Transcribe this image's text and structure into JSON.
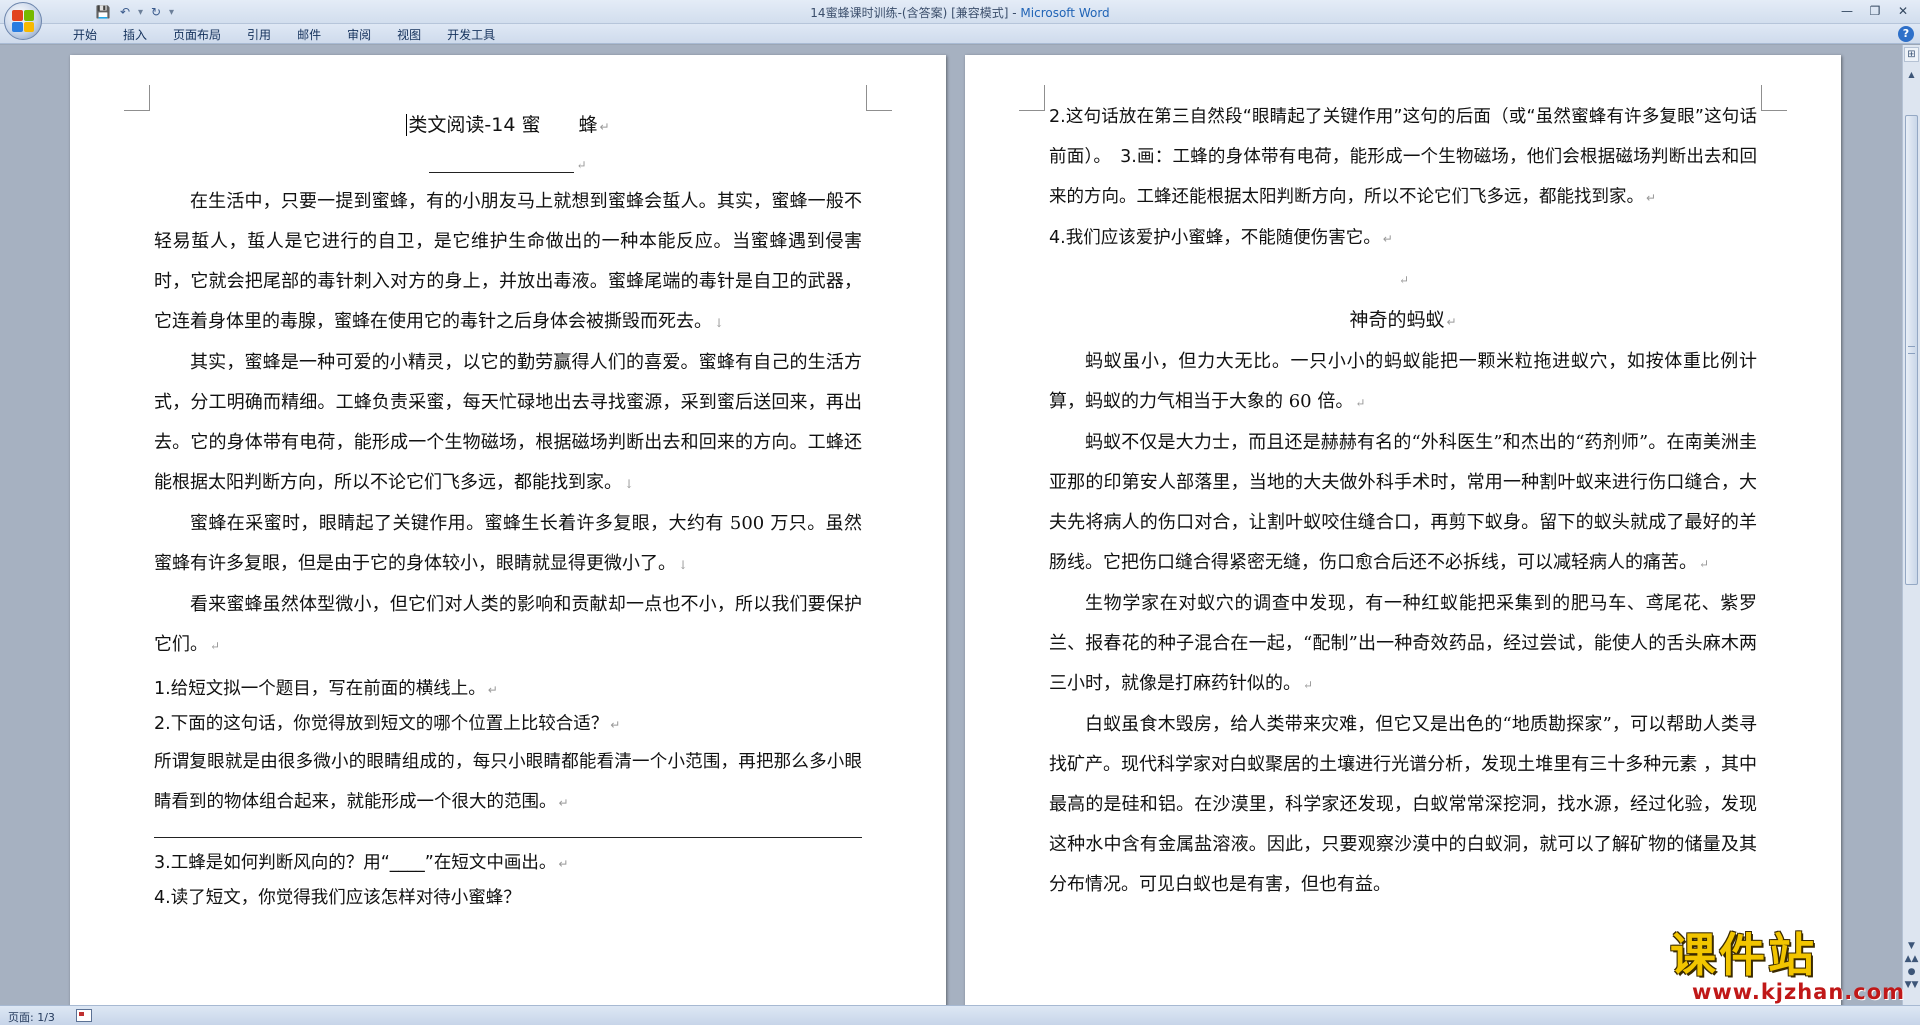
{
  "window": {
    "title": "14蜜蜂课时训练-(含答案) [兼容模式] - ",
    "app_name": "Microsoft Word"
  },
  "quick_access": {
    "save_icon": "save-icon",
    "undo_icon": "undo-icon",
    "redo_icon": "redo-icon"
  },
  "ribbon": {
    "tabs": [
      "开始",
      "插入",
      "页面布局",
      "引用",
      "邮件",
      "审阅",
      "视图",
      "开发工具"
    ],
    "help_label": "?"
  },
  "left_page": {
    "title": "类文阅读-14 蜜　　蜂",
    "paragraphs": [
      "在生活中，只要一提到蜜蜂，有的小朋友马上就想到蜜蜂会蜇人。其实，蜜蜂一般不轻易蜇人，蜇人是它进行的自卫，是它维护生命做出的一种本能反应。当蜜蜂遇到侵害时，它就会把尾部的毒针刺入对方的身上，并放出毒液。蜜蜂尾端的毒针是自卫的武器，它连着身体里的毒腺，蜜蜂在使用它的毒针之后身体会被撕毁而死去。",
      "其实，蜜蜂是一种可爱的小精灵，以它的勤劳赢得人们的喜爱。蜜蜂有自己的生活方式，分工明确而精细。工蜂负责采蜜，每天忙碌地出去寻找蜜源，采到蜜后送回来，再出去。它的身体带有电荷，能形成一个生物磁场，根据磁场判断出去和回来的方向。工蜂还能根据太阳判断方向，所以不论它们飞多远，都能找到家。",
      "蜜蜂在采蜜时，眼睛起了关键作用。蜜蜂生长着许多复眼，大约有 500 万只。虽然蜜蜂有许多复眼，但是由于它的身体较小，眼睛就显得更微小了。",
      "看来蜜蜂虽然体型微小，但它们对人类的影响和贡献却一点也不小，所以我们要保护它们。"
    ],
    "questions": [
      "1.给短文拟一个题目，写在前面的横线上。",
      "2.下面的这句话，你觉得放到短文的哪个位置上比较合适？"
    ],
    "quote": "所谓复眼就是由很多微小的眼睛组成的，每只小眼睛都能看清一个小范围，再把那么多小眼睛看到的物体组合起来，就能形成一个很大的范围。",
    "question3": "3.工蜂是如何判断风向的？用“____”在短文中画出。",
    "question4_partial": "4.读了短文，你觉得我们应该怎样对待小蜜蜂？"
  },
  "right_page": {
    "answers": [
      "2.这句话放在第三自然段“眼睛起了关键作用”这句的后面（或“虽然蜜蜂有许多复眼”这句话前面）。　3.画：工蜂的身体带有电荷，能形成一个生物磁场，他们会根据磁场判断出去和回来的方向。工蜂还能根据太阳判断方向，所以不论它们飞多远，都能找到家。",
      "4.我们应该爱护小蜜蜂，不能随便伤害它。"
    ],
    "section_title": "神奇的蚂蚁",
    "paragraphs": [
      "蚂蚁虽小，但力大无比。一只小小的蚂蚁能把一颗米粒拖进蚁穴，如按体重比例计算，蚂蚁的力气相当于大象的 60 倍。",
      "蚂蚁不仅是大力士，而且还是赫赫有名的“外科医生”和杰出的“药剂师”。在南美洲圭亚那的印第安人部落里，当地的大夫做外科手术时，常用一种割叶蚁来进行伤口缝合，大夫先将病人的伤口对合，让割叶蚁咬住缝合口，再剪下蚁身。留下的蚁头就成了最好的羊肠线。它把伤口缝合得紧密无缝，伤口愈合后还不必拆线，可以减轻病人的痛苦。",
      "生物学家在对蚁穴的调查中发现，有一种红蚁能把采集到的肥马车、鸢尾花、紫罗兰、报春花的种子混合在一起，“配制”出一种奇效药品，经过尝试，能使人的舌头麻木两三小时，就像是打麻药针似的。",
      "白蚁虽食木毁房，给人类带来灾难，但它又是出色的“地质勘探家”，可以帮助人类寻找矿产。现代科学家对白蚁聚居的土壤进行光谱分析，发现土堆里有三十多种元素 ，其中最高的是硅和铝。在沙漠里，科学家还发现，白蚁常常深挖洞，找水源，经过化验，发现这种水中含有金属盐溶液。因此，只要观察沙漠中的白蚁洞，就可以了解矿物的储量及其分布情况。可见白蚁也",
      "是有害，但也有益。"
    ]
  },
  "marks": {
    "paragraph": "↵",
    "line_break": "↓"
  },
  "statusbar": {
    "page_label": "页面: 1/3"
  },
  "watermark": {
    "main": "课件站",
    "url": "www.kjzhan.com"
  }
}
